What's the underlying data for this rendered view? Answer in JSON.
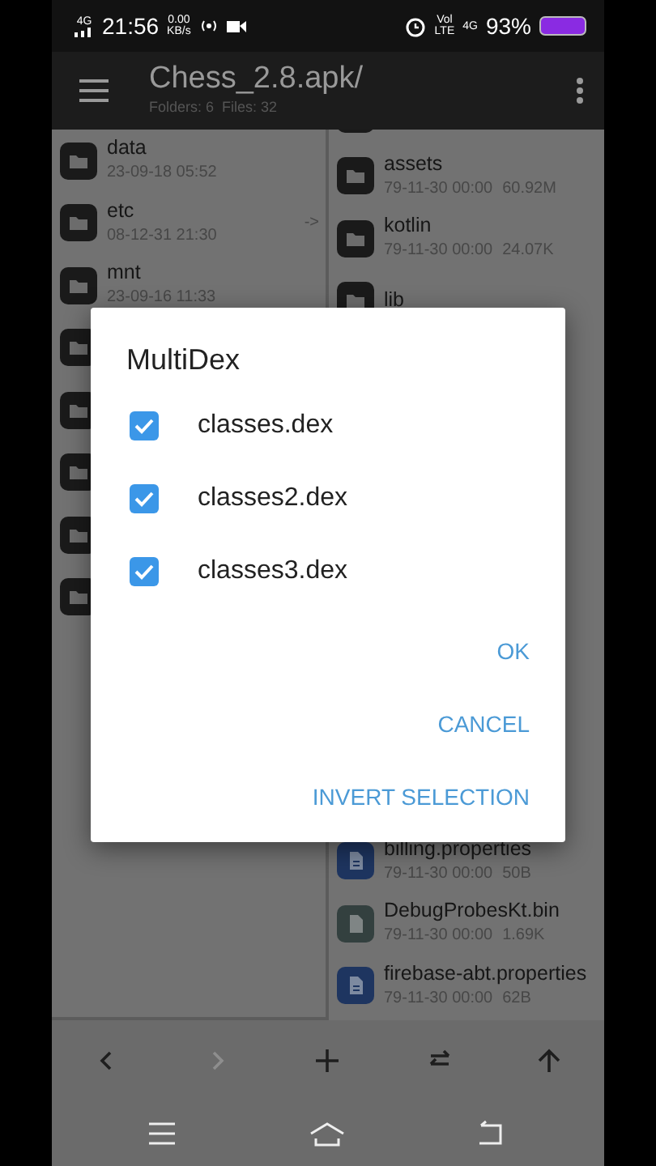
{
  "status_bar": {
    "network": "4G",
    "time": "21:56",
    "speed_value": "0.00",
    "speed_unit": "KB/s",
    "volte": [
      "Vol",
      "LTE"
    ],
    "network_2": "4G",
    "battery": "93%"
  },
  "app_bar": {
    "title": "Chess_2.8.apk/",
    "subtitle": "Folders: 6  Files: 32"
  },
  "left_pane": {
    "items": [
      {
        "kind": "folder",
        "name": "data",
        "date": "23-09-18 05:52"
      },
      {
        "kind": "folder",
        "name": "etc",
        "date": "08-12-31 21:30",
        "link": "->"
      },
      {
        "kind": "folder",
        "name": "mnt",
        "date": "23-09-16 11:33"
      },
      {
        "kind": "folder"
      },
      {
        "kind": "folder"
      },
      {
        "kind": "folder"
      },
      {
        "kind": "folder"
      },
      {
        "kind": "folder"
      }
    ]
  },
  "right_pane": {
    "top_items": [
      {
        "kind": "folder"
      },
      {
        "kind": "folder",
        "name": "assets",
        "date": "79-11-30 00:00",
        "size": "60.92M"
      },
      {
        "kind": "folder",
        "name": "kotlin",
        "date": "79-11-30 00:00",
        "size": "24.07K"
      },
      {
        "kind": "folder",
        "name": "lib"
      }
    ],
    "bottom_items": [
      {
        "kind": "properties",
        "name": "billing.properties",
        "date": "79-11-30 00:00",
        "size": "50B"
      },
      {
        "kind": "binary",
        "name": "DebugProbesKt.bin",
        "date": "79-11-30 00:00",
        "size": "1.69K"
      },
      {
        "kind": "properties",
        "name": "firebase-abt.properties",
        "date": "79-11-30 00:00",
        "size": "62B"
      }
    ]
  },
  "dialog": {
    "title": "MultiDex",
    "options": [
      {
        "label": "classes.dex",
        "checked": true
      },
      {
        "label": "classes2.dex",
        "checked": true
      },
      {
        "label": "classes3.dex",
        "checked": true
      }
    ],
    "buttons": [
      "OK",
      "CANCEL",
      "INVERT SELECTION"
    ]
  },
  "toolbar": [
    {
      "kind": "back",
      "disabled": false
    },
    {
      "kind": "forward",
      "disabled": true
    },
    {
      "kind": "add",
      "disabled": false
    },
    {
      "kind": "swap",
      "disabled": false
    },
    {
      "kind": "up",
      "disabled": false
    }
  ],
  "nav_bar": [
    {
      "kind": "menu"
    },
    {
      "kind": "home"
    },
    {
      "kind": "back"
    }
  ]
}
